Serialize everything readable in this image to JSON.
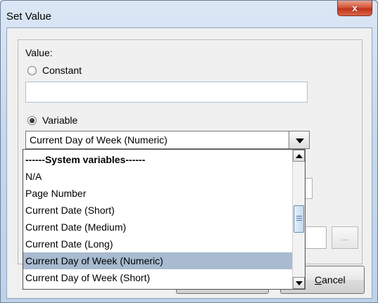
{
  "window": {
    "title": "Set Value",
    "close_label": "x"
  },
  "form": {
    "value_label": "Value:",
    "constant_label": "Constant",
    "constant_value": "",
    "variable_label": "Variable",
    "selected_option": "Current Day of Week (Numeric)",
    "constant_checked": false,
    "variable_checked": true
  },
  "dropdown": {
    "items": [
      {
        "label": "------System variables------",
        "kind": "header"
      },
      {
        "label": "N/A",
        "kind": "option"
      },
      {
        "label": "Page Number",
        "kind": "option"
      },
      {
        "label": "Current Date (Short)",
        "kind": "option"
      },
      {
        "label": "Current Date (Medium)",
        "kind": "option"
      },
      {
        "label": "Current Date (Long)",
        "kind": "option"
      },
      {
        "label": "Current Day of Week (Numeric)",
        "kind": "option",
        "selected": true
      },
      {
        "label": "Current Day of Week (Short)",
        "kind": "option"
      }
    ]
  },
  "buttons": {
    "browse_label": "...",
    "cancel_label": "Cancel",
    "cancel_mnemonic": "C",
    "cancel_rest": "ancel"
  },
  "colors": {
    "selection": "#a8bbd0",
    "titlebar": "#c9d9ec",
    "close_button": "#c0341c"
  }
}
